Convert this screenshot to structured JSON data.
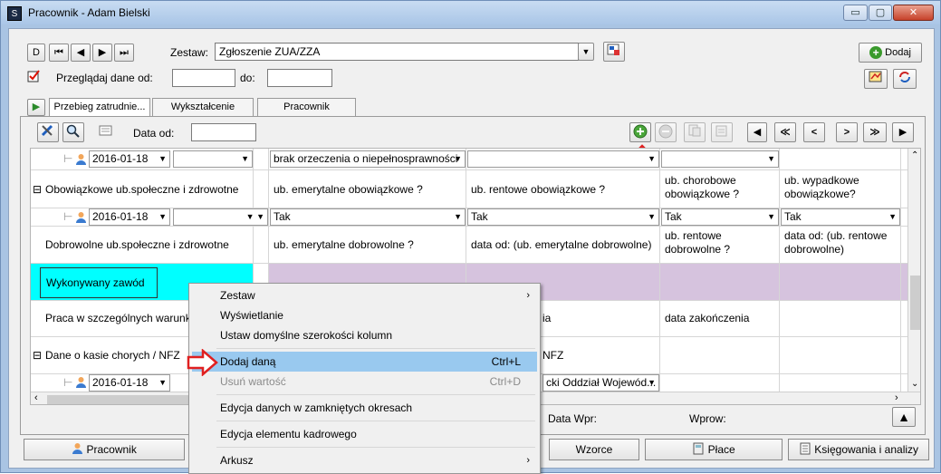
{
  "window": {
    "title": "Pracownik - Adam Bielski",
    "min": "▭",
    "max": "▢",
    "close": "✕"
  },
  "nav": {
    "first": "D",
    "prev_all": "⏮",
    "prev": "◀",
    "next": "▶",
    "last": "⏭"
  },
  "zestaw": {
    "label": "Zestaw:",
    "value": "Zgłoszenie ZUA/ZZA"
  },
  "przegladaj": {
    "label": "Przeglądaj dane od:",
    "od_value": "",
    "do_label": "do:",
    "do_value": ""
  },
  "top_right": {
    "dodaj": "Dodaj"
  },
  "tabs": [
    "Przebieg zatrudnie...",
    "Wykształcenie",
    "Pracownik"
  ],
  "grid_toolbar": {
    "data_od_label": "Data od:",
    "data_od_value": "",
    "nav_first": "◀",
    "nav_prev_page": "≪",
    "nav_prev": "<",
    "nav_next": ">",
    "nav_next_page": "≫",
    "nav_last": "▶"
  },
  "rows": {
    "r1": {
      "date": "2016-01-18",
      "c1": "brak orzeczenia o niepełnosprawności"
    },
    "r2": {
      "label": "Obowiązkowe ub.społeczne i zdrowotne",
      "expander": "⊟",
      "c1": "ub. emerytalne obowiązkowe ?",
      "c2": "ub. rentowe obowiązkowe ?",
      "c3a": "ub. chorobowe",
      "c3b": "obowiązkowe ?",
      "c4a": "ub. wypadkowe",
      "c4b": "obowiązkowe?"
    },
    "r3": {
      "date": "2016-01-18",
      "c1": "Tak",
      "c2": "Tak",
      "c3": "Tak",
      "c4": "Tak"
    },
    "r4": {
      "label": "Dobrowolne ub.społeczne i zdrowotne",
      "c1": "ub. emerytalne dobrowolne ?",
      "c2": "data od: (ub. emerytalne dobrowolne)",
      "c3a": "ub. rentowe",
      "c3b": "dobrowolne ?",
      "c4a": "data od: (ub. rentowe",
      "c4b": "dobrowolne)"
    },
    "r5": {
      "label": "Wykonywany zawód"
    },
    "r6": {
      "label": "Praca w szczególnych warunka",
      "c2": "ia",
      "c3": "data zakończenia"
    },
    "r7": {
      "label": "Dane o kasie chorych / NFZ",
      "expander": "⊟",
      "c2": "NFZ"
    },
    "r8": {
      "date": "2016-01-18",
      "c2": "cki Oddział Wojewód..."
    }
  },
  "footer": {
    "data_wpr": "Data Wpr:",
    "wprow": "Wprow:",
    "up": "🡅"
  },
  "bottom_buttons": [
    "Pracownik",
    "Wzorce",
    "Płace",
    "Księgowania i analizy"
  ],
  "context_menu": [
    {
      "label": "Zestaw",
      "shortcut": "",
      "submenu": true,
      "enabled": true
    },
    {
      "label": "Wyświetlanie",
      "shortcut": "",
      "submenu": false,
      "enabled": true
    },
    {
      "label": "Ustaw domyślne szerokości kolumn",
      "shortcut": "",
      "submenu": false,
      "enabled": true
    },
    {
      "label": "Dodaj daną",
      "shortcut": "Ctrl+L",
      "submenu": false,
      "enabled": true,
      "highlighted": true
    },
    {
      "label": "Usuń wartość",
      "shortcut": "Ctrl+D",
      "submenu": false,
      "enabled": false
    },
    {
      "label": "Edycja danych w zamkniętych okresach",
      "shortcut": "",
      "submenu": false,
      "enabled": true
    },
    {
      "label": "Edycja elementu kadrowego",
      "shortcut": "",
      "submenu": false,
      "enabled": true
    },
    {
      "label": "Arkusz",
      "shortcut": "",
      "submenu": true,
      "enabled": true
    }
  ],
  "colors": {
    "highlight": "#99c9ef",
    "cyan": "#00ffff",
    "lavender": "#d6c3de",
    "arrow_red": "#e02020"
  }
}
